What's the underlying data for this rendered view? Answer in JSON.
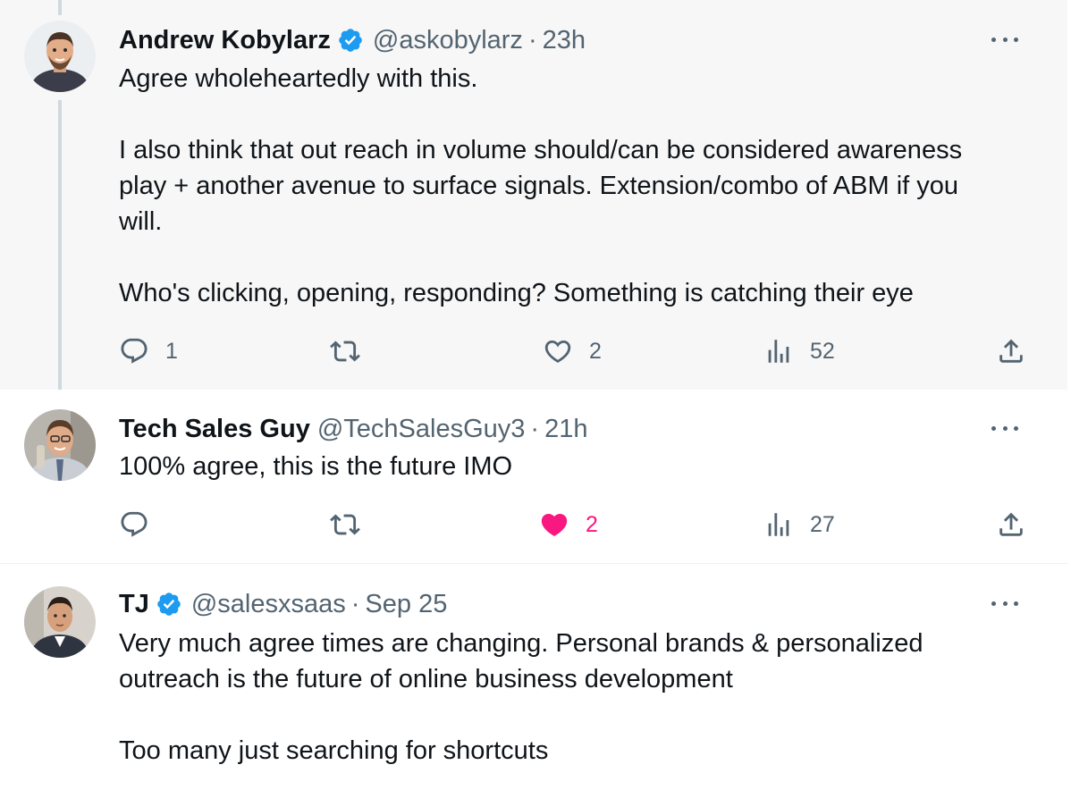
{
  "tweets": [
    {
      "author": {
        "name": "Andrew Kobylarz",
        "handle": "@askobylarz",
        "verified": true
      },
      "time": "23h",
      "lines": [
        "Agree wholeheartedly with this.",
        "",
        "I also think that out reach in volume should/can be considered awareness",
        "play + another avenue to surface signals. Extension/combo of ABM if you",
        "will.",
        "",
        "Who's clicking, opening, responding? Something is catching their eye"
      ],
      "stats": {
        "replies": "1",
        "retweets": "",
        "likes": "2",
        "views": "52"
      }
    },
    {
      "author": {
        "name": "Tech Sales Guy",
        "handle": "@TechSalesGuy3",
        "verified": false
      },
      "time": "21h",
      "lines": [
        "100% agree, this is the future IMO"
      ],
      "stats": {
        "replies": "",
        "retweets": "",
        "likes": "2",
        "views": "27",
        "liked_by_viewer": true
      }
    },
    {
      "author": {
        "name": "TJ",
        "handle": "@salesxsaas",
        "verified": true
      },
      "time": "Sep 25",
      "lines": [
        "Very much agree times are changing. Personal brands & personalized",
        "outreach is the future of online business development",
        "",
        "Too many just searching for shortcuts"
      ]
    }
  ],
  "separator": "·",
  "icons": {
    "reply": "reply-icon",
    "retweet": "retweet-icon",
    "like": "heart-icon",
    "views": "views-icon",
    "share": "share-icon",
    "more": "more-icon",
    "verified": "verified-badge-icon"
  },
  "colors": {
    "text": "#0f1419",
    "secondary": "#536471",
    "verified": "#1d9bf0",
    "like_active": "#f91880",
    "thread_line": "#cfd9de",
    "highlight_bg": "#f7f7f7"
  }
}
